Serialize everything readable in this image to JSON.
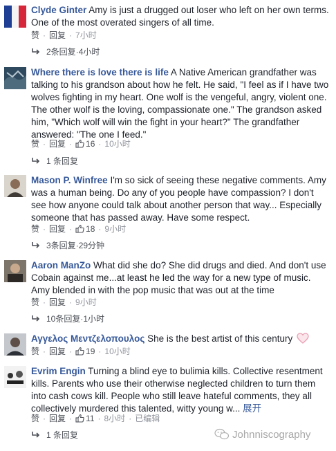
{
  "comments": [
    {
      "author": "Clyde Ginter",
      "text": "Amy is just a drugged out loser who left on her own terms. One of the most overated singers of all time.",
      "like_label": "赞",
      "reply_label": "回复",
      "likes": "",
      "time": "7小时",
      "edited": "",
      "replies_label": "2条回复",
      "replies_time": "4小时",
      "more_label": ""
    },
    {
      "author": "Where there is love there is life",
      "text": "A Native American grandfather was talking to his grandson about how he felt. He said, \"I feel as if I have two wolves fighting in my heart. One wolf is the vengeful, angry, violent one. The other wolf is the loving, compassionate one.\" The grandson asked him, \"Which wolf will win the fight in your heart?\" The grandfather answered: \"The one I feed.\"",
      "like_label": "赞",
      "reply_label": "回复",
      "likes": "16",
      "time": "10小时",
      "edited": "",
      "replies_label": "1 条回复",
      "replies_time": "",
      "more_label": ""
    },
    {
      "author": "Mason P. Winfree",
      "text": "I'm so sick of seeing these negative comments. Amy was a human being. Do any of you people have compassion? I don't see how anyone could talk about another person that way... Especially someone that has passed away. Have some respect.",
      "like_label": "赞",
      "reply_label": "回复",
      "likes": "18",
      "time": "9小时",
      "edited": "",
      "replies_label": "3条回复",
      "replies_time": "29分钟",
      "more_label": ""
    },
    {
      "author": "Aaron ManZo",
      "text": "What did she do? She did drugs and died. And don't use Cobain against me...at least he led the way for a new type of music. Amy blended in with the pop music that was out at the time",
      "like_label": "赞",
      "reply_label": "回复",
      "likes": "",
      "time": "9小时",
      "edited": "",
      "replies_label": "10条回复",
      "replies_time": "1小时",
      "more_label": ""
    },
    {
      "author": "Αγγελος Μεντζελοπουλος",
      "text": "She is the best artist of this century",
      "like_label": "赞",
      "reply_label": "回复",
      "likes": "19",
      "time": "10小时",
      "edited": "",
      "replies_label": "",
      "replies_time": "",
      "more_label": ""
    },
    {
      "author": "Evrim Engin",
      "text": "Turning a blind eye to bulimia kills. Collective resentment kills. Parents who use their otherwise neglected children to turn them into cash cows kill. People who still leave hateful comments, they all collectively murdered this talented, witty young w...",
      "like_label": "赞",
      "reply_label": "回复",
      "likes": "11",
      "time": "8小时",
      "edited": "已编辑",
      "replies_label": "1 条回复",
      "replies_time": "",
      "more_label": "展开"
    }
  ],
  "watermark": "Johnniscography",
  "colors": {
    "link": "#365899",
    "text": "#1d2129",
    "meta": "#90949c",
    "heart": "#e8a0b4"
  },
  "icons": [
    "thumbs-up-icon",
    "reply-arrow-icon",
    "heart-icon",
    "wechat-icon"
  ]
}
